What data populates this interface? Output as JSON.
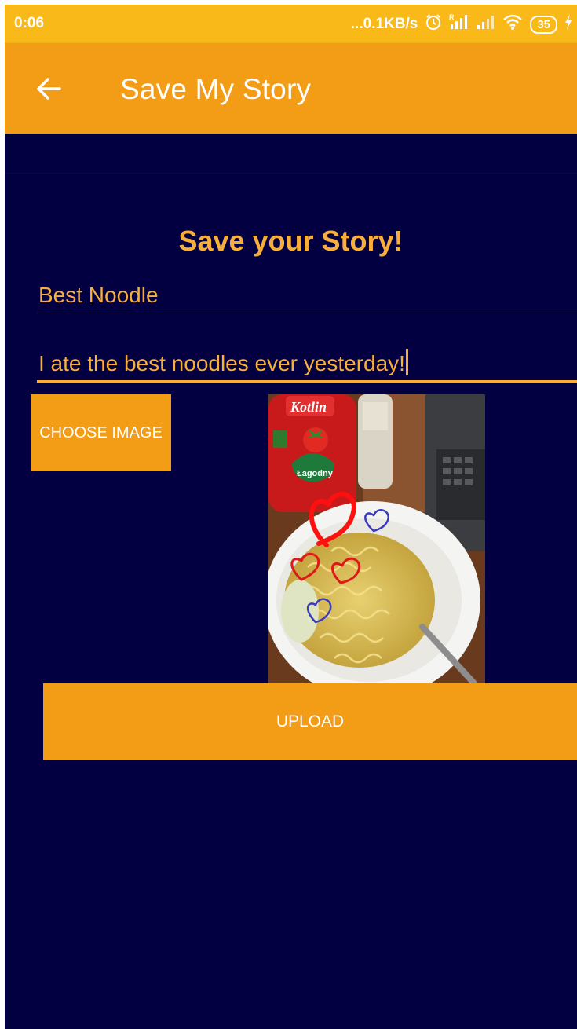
{
  "status_bar": {
    "time": "0:06",
    "network_speed": "...0.1KB/s",
    "battery": "35",
    "icons": [
      "alarm-icon",
      "signal-r-icon",
      "signal-icon",
      "wifi-icon",
      "battery-icon",
      "charging-icon"
    ]
  },
  "app_bar": {
    "title": "Save My Story",
    "back_icon": "arrow-left-icon"
  },
  "form": {
    "heading": "Save your Story!",
    "title_value": "Best Noodle",
    "story_value": "I ate the best noodles ever yesterday!",
    "choose_image_label": "CHOOSE IMAGE",
    "upload_label": "UPLOAD"
  },
  "photo": {
    "ketchup_brand": "Kotlin",
    "ketchup_label": "Łagodny"
  },
  "colors": {
    "status_bar": "#f9b919",
    "accent": "#f39c16",
    "text_accent": "#f7ae3a",
    "background": "#020041"
  }
}
